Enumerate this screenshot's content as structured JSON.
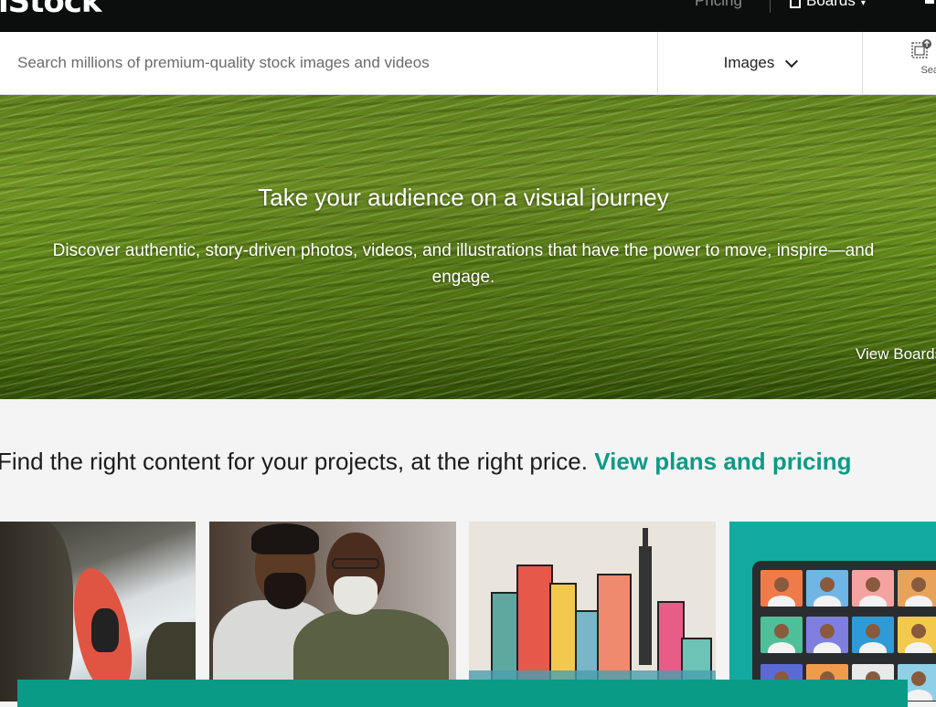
{
  "nav": {
    "logo_text": "iStock",
    "pricing_label": "Pricing",
    "boards_label": "Boards"
  },
  "search": {
    "placeholder": "Search millions of premium-quality stock images and videos",
    "type_selected": "Images",
    "search_by_image_label": "Search by\nor vide"
  },
  "hero": {
    "title": "Take your audience on a visual journey",
    "subtitle": "Discover authentic, story-driven photos, videos, and illustrations that have the power to move, inspire—and engage.",
    "view_boards_label": "View Boards"
  },
  "promo": {
    "text": "Find the right content for your projects, at the right price.",
    "link_label": "View plans and pricing"
  },
  "tiles": [
    {
      "icon": "kayaker-waterfall-photo"
    },
    {
      "icon": "two-men-portrait-photo"
    },
    {
      "icon": "city-illustration"
    },
    {
      "icon": "video-call-illustration"
    }
  ],
  "colors": {
    "accent": "#0a9b86",
    "nav_bg": "#0c0d0d",
    "page_bg": "#f4f4f4"
  }
}
